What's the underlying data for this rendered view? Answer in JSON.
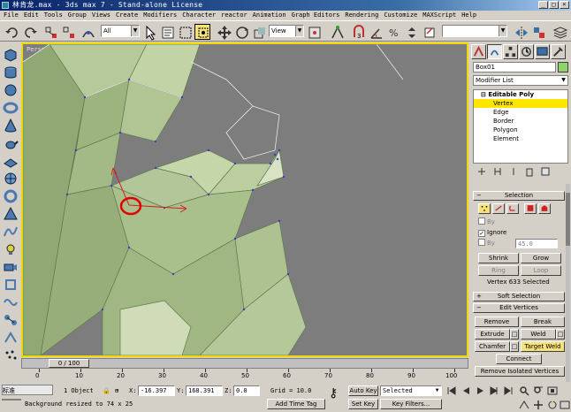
{
  "window": {
    "title": "林肯龙.max - 3ds max 7 - Stand-alone License",
    "buttons": [
      "_",
      "□",
      "×"
    ]
  },
  "menu": [
    "File",
    "Edit",
    "Tools",
    "Group",
    "Views",
    "Create",
    "Modifiers",
    "Character",
    "reactor",
    "Animation",
    "Graph Editors",
    "Rendering",
    "Customize",
    "MAXScript",
    "Help"
  ],
  "toolbar": {
    "selection_filter": "All",
    "reference_coord": "View",
    "named_selection": ""
  },
  "viewport": {
    "label": "Perspective",
    "accent": "#f0d800",
    "mesh_color": "#a9c08a",
    "vertex_color": "#3a3ad8"
  },
  "timeline": {
    "slider_label": "0 / 100",
    "ticks": [
      "0",
      "10",
      "20",
      "30",
      "40",
      "50",
      "60",
      "70",
      "80",
      "90",
      "100"
    ]
  },
  "command_panel": {
    "object_name": "Box01",
    "object_color": "#8fd46b",
    "modifier_list": "Modifier List",
    "stack": {
      "head": "Editable Poly",
      "items": [
        "Vertex",
        "Edge",
        "Border",
        "Polygon",
        "Element"
      ],
      "selected": "Vertex"
    },
    "selection_rollout": {
      "title": "Selection",
      "by_label": "By",
      "ignore_label": "Ignore",
      "by_angle_label": "By",
      "angle_value": "45.0",
      "shrink": "Shrink",
      "grow": "Grow",
      "ring": "Ring",
      "loop": "Loop",
      "status": "Vertex 633 Selected"
    },
    "soft_selection_title": "Soft Selection",
    "edit_vertices": {
      "title": "Edit Vertices",
      "remove": "Remove",
      "break": "Break",
      "extrude": "Extrude",
      "weld": "Weld",
      "chamfer": "Chamfer",
      "target_weld": "Target Weld",
      "connect": "Connect",
      "remove_isolated": "Remove Isolated Vertices"
    }
  },
  "status": {
    "ime_label": "标准",
    "selection_count": "1 Object",
    "x_label": "X:",
    "x_value": "-16.397",
    "y_label": "Y:",
    "y_value": "168.391",
    "z_label": "Z:",
    "z_value": "0.0",
    "grid": "Grid = 10.0",
    "auto_key": "Auto Key",
    "set_key": "Set Key",
    "key_mode": "Selected",
    "key_filters": "Key Filters...",
    "prompt": "Background resized to 74 x 25",
    "add_time_tag": "Add Time Tag"
  }
}
